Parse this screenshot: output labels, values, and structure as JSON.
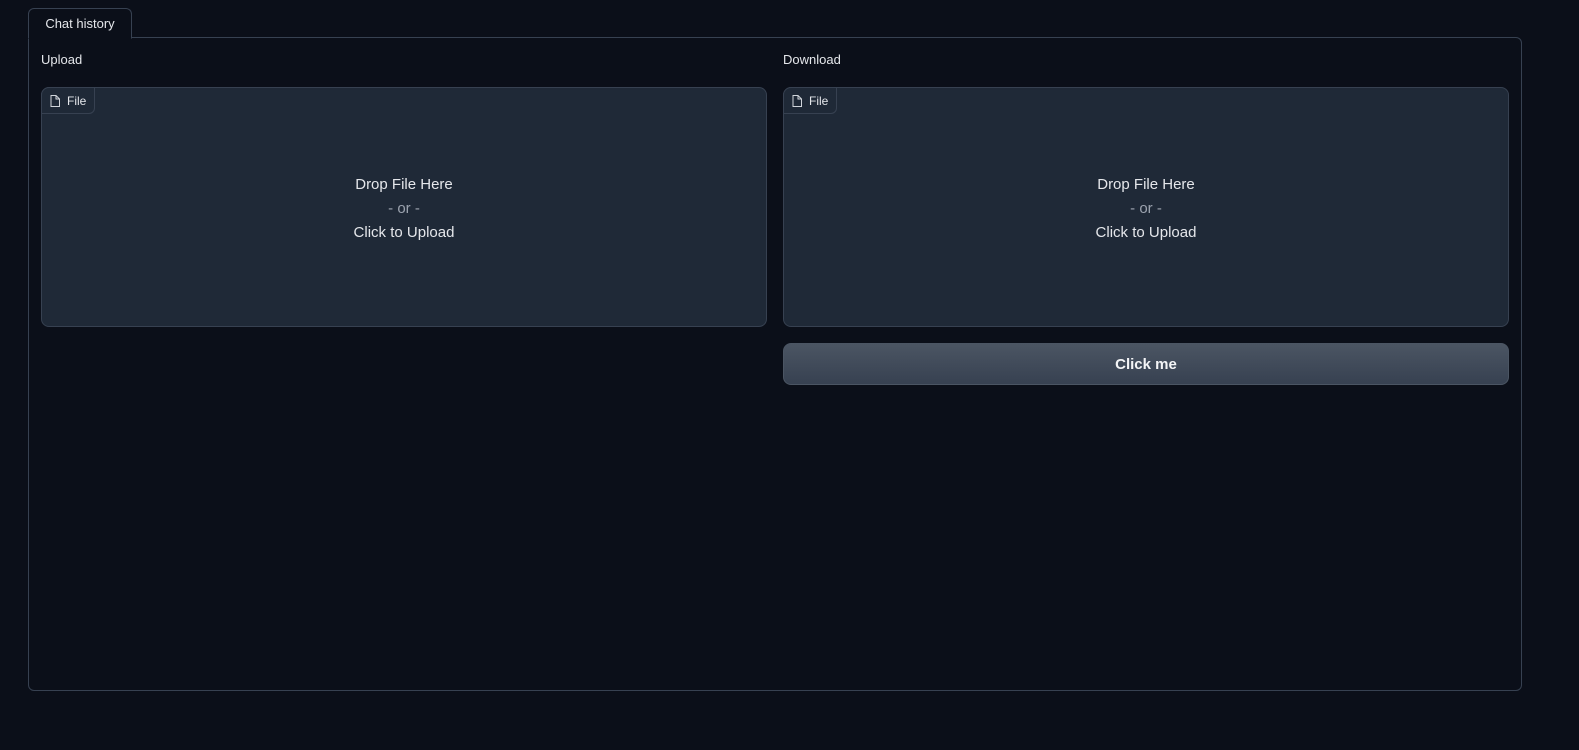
{
  "tabs": [
    {
      "label": "Chat history",
      "active": true
    }
  ],
  "upload": {
    "label": "Upload",
    "badge": "File",
    "drop_text": "Drop File Here",
    "or_text": "- or -",
    "click_text": "Click to Upload"
  },
  "download": {
    "label": "Download",
    "badge": "File",
    "drop_text": "Drop File Here",
    "or_text": "- or -",
    "click_text": "Click to Upload"
  },
  "button": {
    "label": "Click me"
  },
  "icons": {
    "file_badge": "file-icon"
  },
  "colors": {
    "background": "#0b0f19",
    "border": "#374151",
    "dropzone": "#1f2937",
    "button_top": "#4b5563",
    "button_bottom": "#374151",
    "text": "#e5e7eb",
    "muted": "#9ca3af"
  }
}
